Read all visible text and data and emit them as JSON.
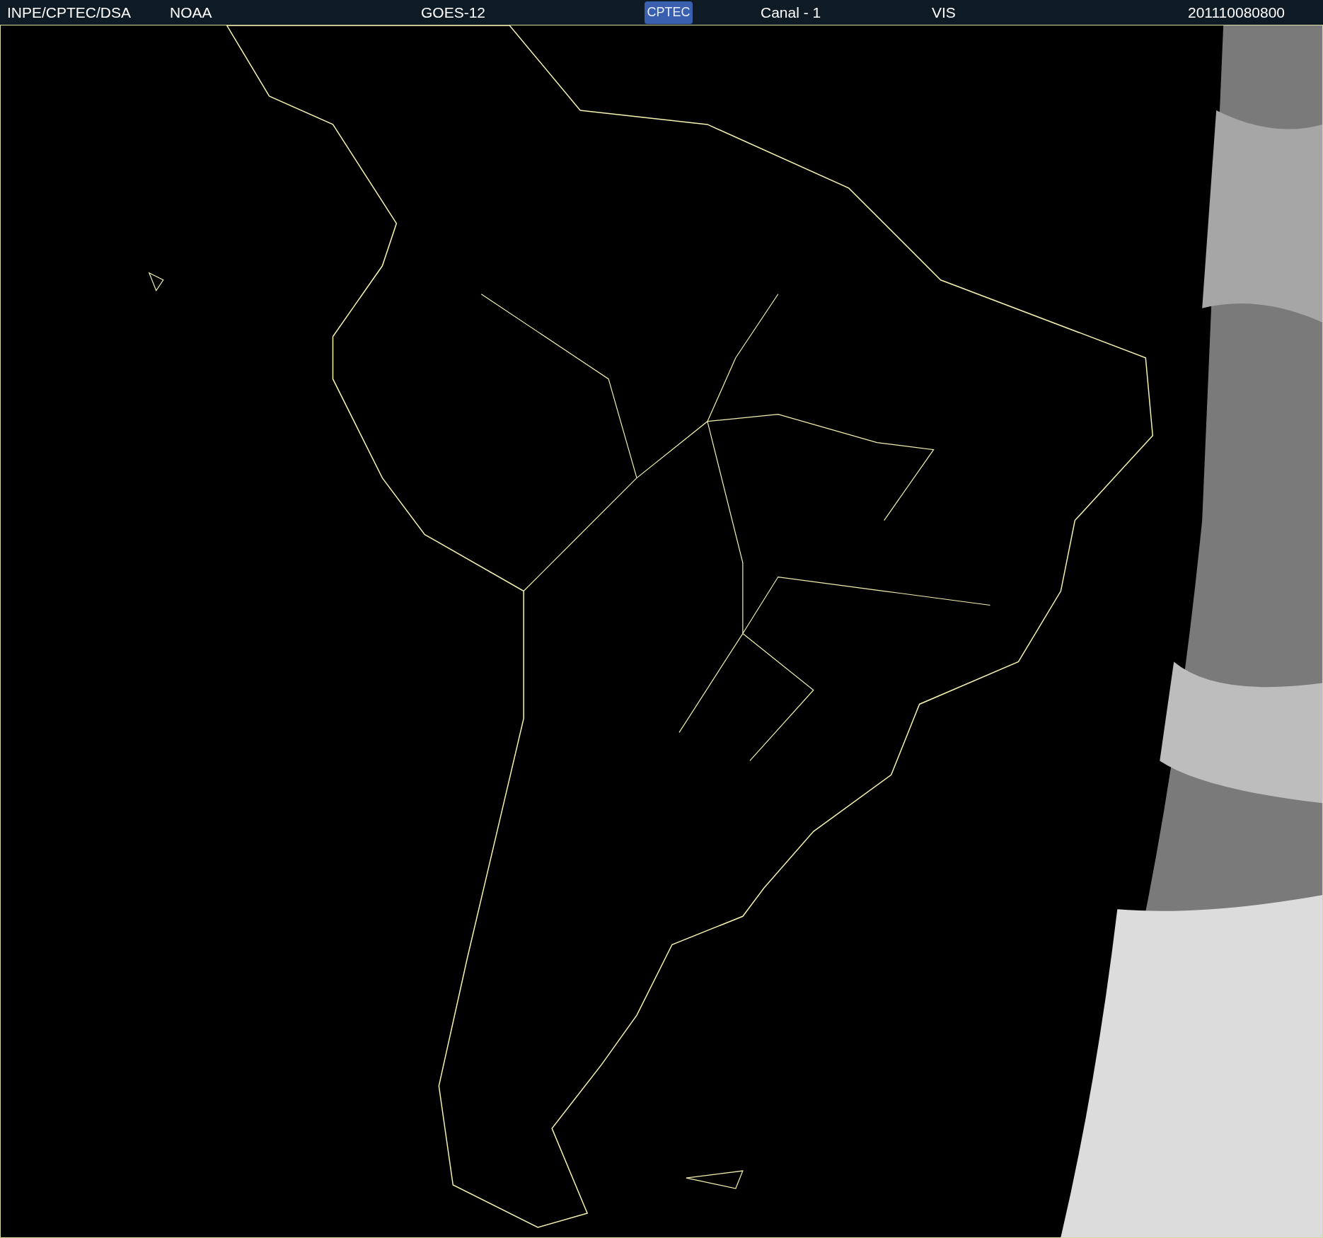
{
  "header": {
    "source": "INPE/CPTEC/DSA",
    "agency": "NOAA",
    "satellite": "GOES-12",
    "logo": "CPTEC",
    "channel": "Canal - 1",
    "band": "VIS",
    "timestamp": "201110080800"
  }
}
